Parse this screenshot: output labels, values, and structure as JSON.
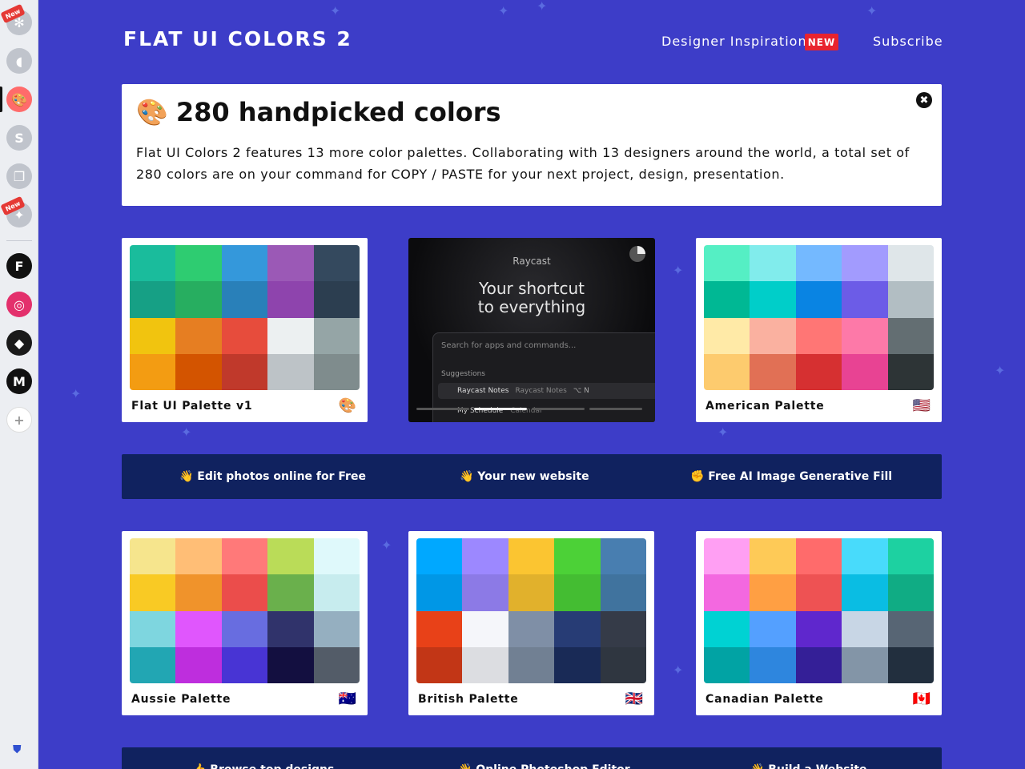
{
  "sidebar": {
    "new_badge": "New",
    "items": [
      {
        "name": "app-1-icon",
        "glyph": "✻",
        "bg": "#c0c4cc",
        "new": true
      },
      {
        "name": "app-2-icon",
        "glyph": "◖",
        "bg": "#c0c4cc"
      },
      {
        "name": "flat-ui-colors-icon",
        "glyph": "🎨",
        "bg": "#ff6b6b",
        "active": true
      },
      {
        "name": "app-s-icon",
        "glyph": "S",
        "bg": "#c0c4cc"
      },
      {
        "name": "app-stack-icon",
        "glyph": "❐",
        "bg": "#c0c4cc"
      },
      {
        "name": "app-sparkle-icon",
        "glyph": "✦",
        "bg": "#c0c4cc",
        "new": true
      },
      {
        "name": "framer-icon",
        "glyph": "F",
        "bg": "#111111"
      },
      {
        "name": "creative-cloud-icon",
        "glyph": "◎",
        "bg": "#e3306c"
      },
      {
        "name": "app-red-icon",
        "glyph": "◆",
        "bg": "#1a1a1a"
      },
      {
        "name": "app-m-icon",
        "glyph": "M",
        "bg": "#111111"
      },
      {
        "name": "add-app-icon",
        "glyph": "+",
        "bg": "#ffffff"
      }
    ]
  },
  "header": {
    "brand": "FLAT UI COLORS 2",
    "nav": {
      "inspiration": "Designer Inspiration",
      "new_badge": "NEW",
      "subscribe": "Subscribe"
    }
  },
  "intro": {
    "emoji": "🎨",
    "title": "280 handpicked colors",
    "description": "Flat UI Colors 2 features 13 more color palettes. Collaborating with 13 designers around the world, a total set of 280 colors are on your command for COPY / PASTE for your next project, design, presentation.",
    "close_glyph": "✖"
  },
  "palettes": [
    {
      "name": "Flat UI Palette v1",
      "flag": "🎨",
      "colors": [
        "#1abc9c",
        "#2ecc71",
        "#3498db",
        "#9b59b6",
        "#34495e",
        "#16a085",
        "#27ae60",
        "#2980b9",
        "#8e44ad",
        "#2c3e50",
        "#f1c40f",
        "#e67e22",
        "#e74c3c",
        "#ecf0f1",
        "#95a5a6",
        "#f39c12",
        "#d35400",
        "#c0392b",
        "#bdc3c7",
        "#7f8c8d"
      ]
    },
    {
      "name": "American Palette",
      "flag": "🇺🇸",
      "colors": [
        "#55efc4",
        "#81ecec",
        "#74b9ff",
        "#a29bfe",
        "#dfe6e9",
        "#00b894",
        "#00cec9",
        "#0984e3",
        "#6c5ce7",
        "#b2bec3",
        "#ffeaa7",
        "#fab1a0",
        "#ff7675",
        "#fd79a8",
        "#636e72",
        "#fdcb6e",
        "#e17055",
        "#d63031",
        "#e84393",
        "#2d3436"
      ]
    },
    {
      "name": "Aussie Palette",
      "flag": "🇦🇺",
      "colors": [
        "#f6e58d",
        "#ffbe76",
        "#ff7979",
        "#badc58",
        "#dff9fb",
        "#f9ca24",
        "#f0932b",
        "#eb4d4b",
        "#6ab04c",
        "#c7ecee",
        "#7ed6df",
        "#e056fd",
        "#686de0",
        "#30336b",
        "#95afc0",
        "#22a6b3",
        "#be2edd",
        "#4834d4",
        "#130f40",
        "#535c68"
      ]
    },
    {
      "name": "British Palette",
      "flag": "🇬🇧",
      "colors": [
        "#00a8ff",
        "#9c88ff",
        "#fbc531",
        "#4cd137",
        "#487eb0",
        "#0097e6",
        "#8c7ae6",
        "#e1b12c",
        "#44bd32",
        "#40739e",
        "#e84118",
        "#f5f6fa",
        "#7f8fa6",
        "#273c75",
        "#353b48",
        "#c23616",
        "#dcdde1",
        "#718093",
        "#192a56",
        "#2f3640"
      ]
    },
    {
      "name": "Canadian Palette",
      "flag": "🇨🇦",
      "colors": [
        "#ff9ff3",
        "#feca57",
        "#ff6b6b",
        "#48dbfb",
        "#1dd1a1",
        "#f368e0",
        "#ff9f43",
        "#ee5253",
        "#0abde3",
        "#10ac84",
        "#00d2d3",
        "#54a0ff",
        "#5f27cd",
        "#c8d6e5",
        "#576574",
        "#01a3a4",
        "#2e86de",
        "#341f97",
        "#8395a7",
        "#222f3e"
      ]
    }
  ],
  "ad": {
    "brand": "Raycast",
    "headline_1": "Your shortcut",
    "headline_2": "to everything",
    "search_placeholder": "Search for apps and commands...",
    "suggestions_label": "Suggestions",
    "row1_title": "Raycast Notes",
    "row1_subtitle": "Raycast Notes",
    "row1_keys": "⌥ N",
    "row2_title": "My Schedule",
    "row2_subtitle": "Calendar"
  },
  "linkbar_1": {
    "items": [
      "👋 Edit photos online for Free",
      "👋 Your new website",
      "✊ Free AI Image Generative Fill"
    ]
  },
  "linkbar_2": {
    "items": [
      "👍 Browse top designs",
      "👋 Online Photoshop Editor",
      "👋 Build a Website"
    ]
  }
}
